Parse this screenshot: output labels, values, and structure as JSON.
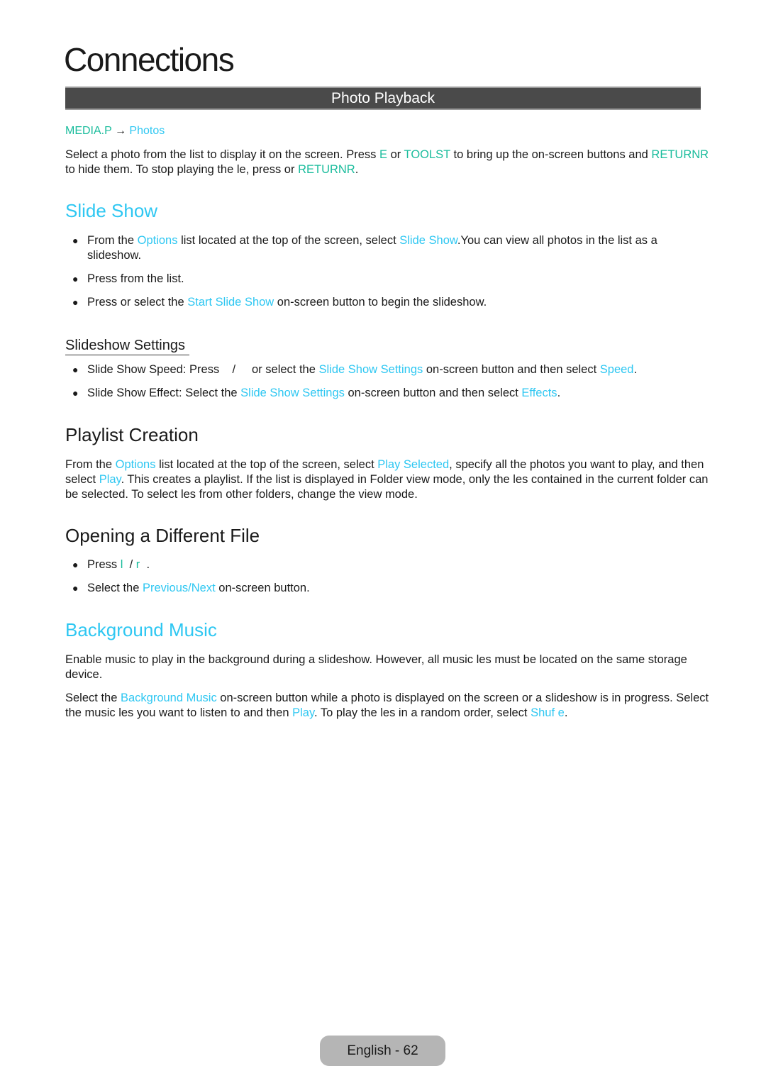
{
  "page": {
    "title": "Connections",
    "section_bar": "Photo Playback",
    "footer": "English - 62"
  },
  "colors": {
    "teal_key": "#1abc9c",
    "blue_menu": "#2ec7f2",
    "bar_bg": "#4a4a4a",
    "footer_bg": "#b5b5b5"
  },
  "breadcrumb": {
    "root": "MEDIA.P",
    "arrow": "→",
    "leaf": "Photos"
  },
  "intro": {
    "t1": "Select a photo from the list to display it on the screen. Press ",
    "k1": "E",
    "t2": " or ",
    "k2": "TOOLST",
    "t3": " to bring up the on-screen buttons and ",
    "k3": "RETURNR",
    "t4": " to hide them. To stop playing the  le, press    or ",
    "k4": "RETURNR",
    "t5": "."
  },
  "slide_show": {
    "heading": "Slide Show",
    "bullets": [
      {
        "t1": "From the ",
        "m1": "Options",
        "t2": " list located at the top of the screen, select ",
        "m2": "Slide Show",
        "t3": ".You can view all photos in the list as a slideshow."
      },
      {
        "t1": "Press    from the list."
      },
      {
        "t1": "Press    or select the ",
        "m1": "Start Slide Show",
        "t2": " on-screen button to begin the slideshow."
      }
    ]
  },
  "slideshow_settings": {
    "heading": "Slideshow Settings",
    "bullets": [
      {
        "t1": "Slide Show Speed: Press    /     or select the ",
        "m1": "Slide Show Settings",
        "t2": " on-screen button and then select ",
        "m2": "Speed",
        "t3": "."
      },
      {
        "t1": "Slide Show Effect: Select the ",
        "m1": "Slide Show Settings",
        "t2": " on-screen button and then select ",
        "m2": "Effects",
        "t3": "."
      }
    ]
  },
  "playlist": {
    "heading": "Playlist Creation",
    "t1": "From the ",
    "m1": "Options",
    "t2": " list located at the top of the screen, select ",
    "m2": "Play Selected",
    "t3": ", specify all the photos you want to play, and then select ",
    "m3": "Play",
    "t4": ". This creates a playlist. If the list is displayed in Folder view mode, only the  les contained in the current folder can be selected. To select  les from other folders, change the view mode."
  },
  "opening": {
    "heading": "Opening a Different File",
    "bullets": [
      {
        "t1": "Press ",
        "k1": "l",
        "t2": "  / ",
        "k2": "r",
        "t3": "  ."
      },
      {
        "t1": "Select the ",
        "m1": "Previous/Next",
        "t2": " on-screen button."
      }
    ]
  },
  "background_music": {
    "heading": "Background Music",
    "p1": "Enable music to play in the background during a slideshow. However, all music  les must be located on the same storage device.",
    "p2": {
      "t1": "Select the ",
      "m1": "Background Music",
      "t2": " on-screen button while a photo is displayed on the screen or a slideshow is in progress. Select the music  les you want to listen to and then ",
      "m2": "Play",
      "t3": ". To play the  les in a random order, select ",
      "m3": "Shuf e",
      "t4": "."
    }
  }
}
